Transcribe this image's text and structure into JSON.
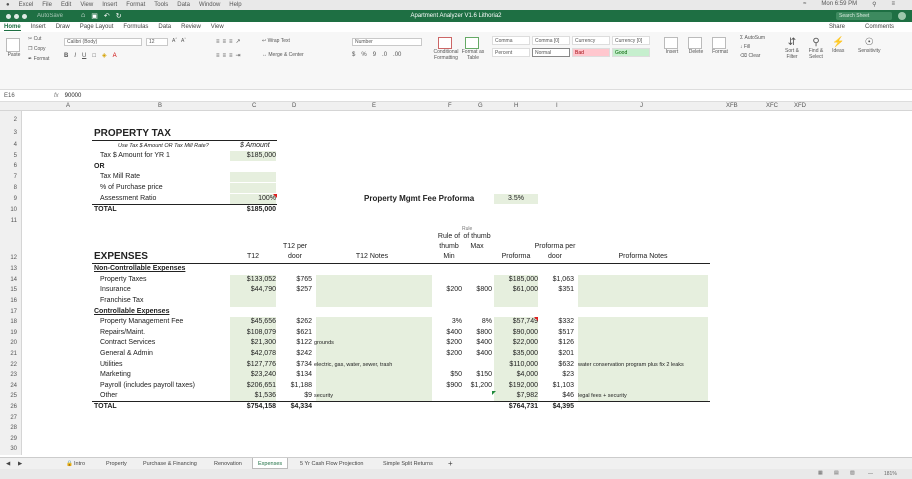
{
  "mac_menu": [
    "Excel",
    "File",
    "Edit",
    "View",
    "Insert",
    "Format",
    "Tools",
    "Data",
    "Window",
    "Help"
  ],
  "clock": "Mon 6:59 PM",
  "window": {
    "autosave": "AutoSave",
    "title": "Apartment Analyzer V1.6 Lithoria2",
    "search_placeholder": "Search Sheet"
  },
  "ribbon_tabs": [
    "Home",
    "Insert",
    "Draw",
    "Page Layout",
    "Formulas",
    "Data",
    "Review",
    "View"
  ],
  "ribbon_right": {
    "share": "Share",
    "comments": "Comments"
  },
  "ribbon": {
    "paste": "Paste",
    "cut": "Cut",
    "copy": "Copy",
    "format": "Format",
    "font_name": "Calibri (Body)",
    "font_size": "12",
    "wrap_text": "Wrap Text",
    "merge_center": "Merge & Center",
    "number_format": "Number",
    "conditional": "Conditional Formatting",
    "format_table": "Format as Table",
    "styles": [
      "Comma",
      "Comma [0]",
      "Currency",
      "Currency [0]",
      "Percent",
      "Normal",
      "Bad",
      "Good"
    ],
    "insert": "Insert",
    "delete": "Delete",
    "format_cells": "Format",
    "autosum": "AutoSum",
    "fill": "Fill",
    "clear": "Clear",
    "sort_filter": "Sort & Filter",
    "find_select": "Find & Select",
    "ideas": "Ideas",
    "sensitivity": "Sensitivity"
  },
  "formula_bar": {
    "cell_ref": "E16",
    "fx": "fx",
    "value": "90000"
  },
  "columns": [
    "A",
    "B",
    "C",
    "D",
    "E",
    "F",
    "G",
    "H",
    "I",
    "J",
    "XFB",
    "XFC",
    "XFD"
  ],
  "rows": [
    "2",
    "3",
    "4",
    "5",
    "6",
    "7",
    "8",
    "9",
    "10",
    "11",
    "12",
    "13",
    "14",
    "15",
    "16",
    "17",
    "18",
    "19",
    "20",
    "21",
    "22",
    "23",
    "24",
    "25",
    "26",
    "27",
    "28",
    "29",
    "30"
  ],
  "property_tax": {
    "title": "PROPERTY TAX",
    "question": "Use Tax $ Amount OR Tax Mill Rate?",
    "amount_header": "$ Amount",
    "yr1_label": "Tax $ Amount for YR 1",
    "yr1_value": "$185,000",
    "or": "OR",
    "mill_rate": "Tax Mill Rate",
    "purchase_pct": "% of Purchase price",
    "assessment_label": "Assessment Ratio",
    "assessment_value": "100%",
    "total_label": "TOTAL",
    "total_value": "$185,000"
  },
  "mgmt_fee": {
    "label": "Property Mgmt Fee Proforma",
    "value": "3.5%"
  },
  "expenses": {
    "title": "EXPENSES",
    "headers": {
      "t12": "T12",
      "t12_per_door": "T12 per door",
      "t12_notes": "T12 Notes",
      "rule_min": "Rule of thumb Min",
      "rule_max": "of thumb Max",
      "rule_top": "Rule",
      "proforma": "Proforma",
      "proforma_per_door": "Proforma per door",
      "proforma_notes": "Proforma Notes"
    },
    "non_controllable": "Non-Controllable Expenses",
    "controllable": "Controllable Expenses",
    "items": [
      {
        "label": "Property Taxes",
        "t12": "$133,052",
        "per_door": "$765",
        "t12_notes": "",
        "min": "",
        "max": "",
        "proforma": "$185,000",
        "pf_door": "$1,063",
        "pf_notes": ""
      },
      {
        "label": "Insurance",
        "t12": "$44,790",
        "per_door": "$257",
        "t12_notes": "",
        "min": "$200",
        "max": "$800",
        "proforma": "$61,000",
        "pf_door": "$351",
        "pf_notes": ""
      },
      {
        "label": "Franchise Tax",
        "t12": "",
        "per_door": "",
        "t12_notes": "",
        "min": "",
        "max": "",
        "proforma": "",
        "pf_door": "",
        "pf_notes": ""
      },
      {
        "label": "Property Management Fee",
        "t12": "$45,656",
        "per_door": "$262",
        "t12_notes": "",
        "min": "3%",
        "max": "8%",
        "proforma": "$57,749",
        "pf_door": "$332",
        "pf_notes": ""
      },
      {
        "label": "Repairs/Maint.",
        "t12": "$108,079",
        "per_door": "$621",
        "t12_notes": "",
        "min": "$400",
        "max": "$800",
        "proforma": "$90,000",
        "pf_door": "$517",
        "pf_notes": ""
      },
      {
        "label": "Contract Services",
        "t12": "$21,300",
        "per_door": "$122",
        "t12_notes": "grounds",
        "min": "$200",
        "max": "$400",
        "proforma": "$22,000",
        "pf_door": "$126",
        "pf_notes": ""
      },
      {
        "label": "General & Admin",
        "t12": "$42,078",
        "per_door": "$242",
        "t12_notes": "",
        "min": "$200",
        "max": "$400",
        "proforma": "$35,000",
        "pf_door": "$201",
        "pf_notes": ""
      },
      {
        "label": "Utilities",
        "t12": "$127,776",
        "per_door": "$734",
        "t12_notes": "electric, gas, water, sewer, trash",
        "min": "",
        "max": "",
        "proforma": "$110,000",
        "pf_door": "$632",
        "pf_notes": "water conservation program plus fix 2 leaks"
      },
      {
        "label": "Marketing",
        "t12": "$23,240",
        "per_door": "$134",
        "t12_notes": "",
        "min": "$50",
        "max": "$150",
        "proforma": "$4,000",
        "pf_door": "$23",
        "pf_notes": ""
      },
      {
        "label": "Payroll (includes payroll taxes)",
        "t12": "$206,651",
        "per_door": "$1,188",
        "t12_notes": "",
        "min": "$900",
        "max": "$1,200",
        "proforma": "$192,000",
        "pf_door": "$1,103",
        "pf_notes": ""
      },
      {
        "label": "Other",
        "t12": "$1,536",
        "per_door": "$9",
        "t12_notes": "security",
        "min": "",
        "max": "",
        "proforma": "$7,982",
        "pf_door": "$46",
        "pf_notes": "legal fees + security"
      }
    ],
    "total": {
      "label": "TOTAL",
      "t12": "$754,158",
      "per_door": "$4,334",
      "proforma": "$764,731",
      "pf_door": "$4,395"
    }
  },
  "sheet_tabs": [
    "Intro",
    "Property",
    "Purchase & Financing",
    "Renovation",
    "Expenses",
    "5 Yr Cash Flow Projection",
    "Simple Split Returns"
  ],
  "active_sheet": "Expenses",
  "add_sheet": "+",
  "zoom": "181%"
}
